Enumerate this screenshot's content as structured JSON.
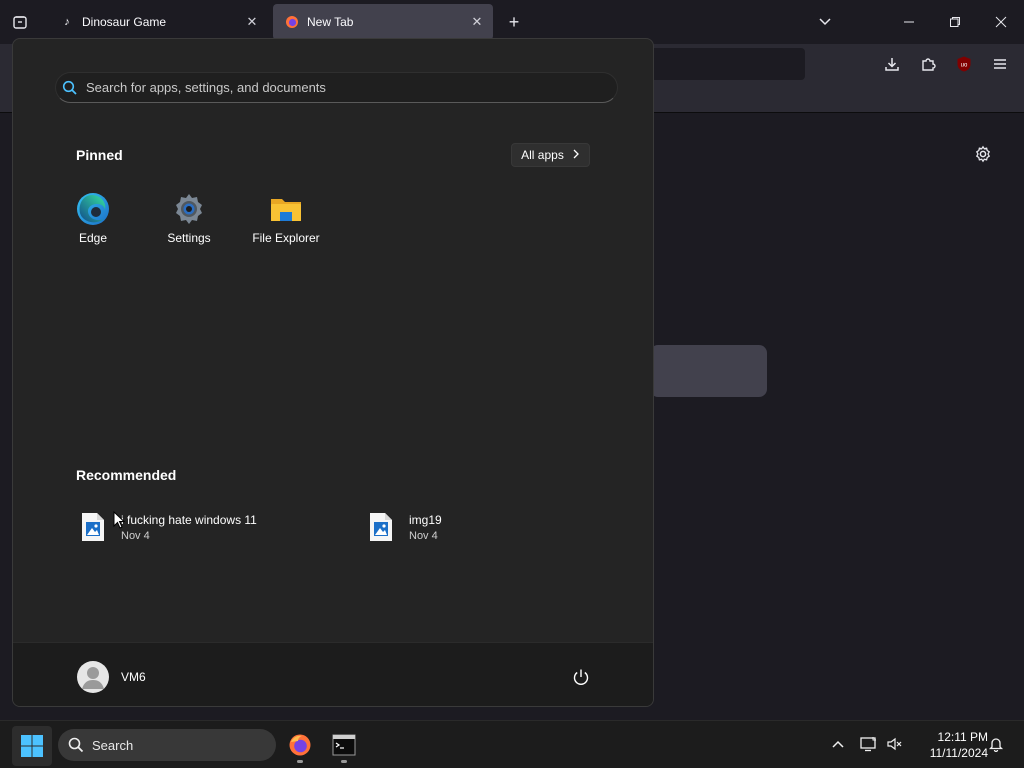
{
  "browser": {
    "tabs": [
      {
        "title": "Dinosaur Game",
        "active": false
      },
      {
        "title": "New Tab",
        "active": true
      }
    ],
    "extension_badge": "uo"
  },
  "start_menu": {
    "search_placeholder": "Search for apps, settings, and documents",
    "pinned_title": "Pinned",
    "all_apps_label": "All apps",
    "pinned": [
      {
        "label": "Edge",
        "icon": "edge-icon"
      },
      {
        "label": "Settings",
        "icon": "settings-gear-icon"
      },
      {
        "label": "File Explorer",
        "icon": "folder-icon"
      }
    ],
    "recommended_title": "Recommended",
    "recommended": [
      {
        "name": "i fucking hate windows 11",
        "date": "Nov 4",
        "icon": "image-file-icon"
      },
      {
        "name": "img19",
        "date": "Nov 4",
        "icon": "image-file-icon"
      }
    ],
    "user": {
      "name": "VM6"
    }
  },
  "taskbar": {
    "search_label": "Search",
    "time": "12:11 PM",
    "date": "11/11/2024"
  },
  "colors": {
    "accent_blue": "#0078d4",
    "windows_logo": "#4cc2ff",
    "folder_yellow": "#f8c234"
  }
}
